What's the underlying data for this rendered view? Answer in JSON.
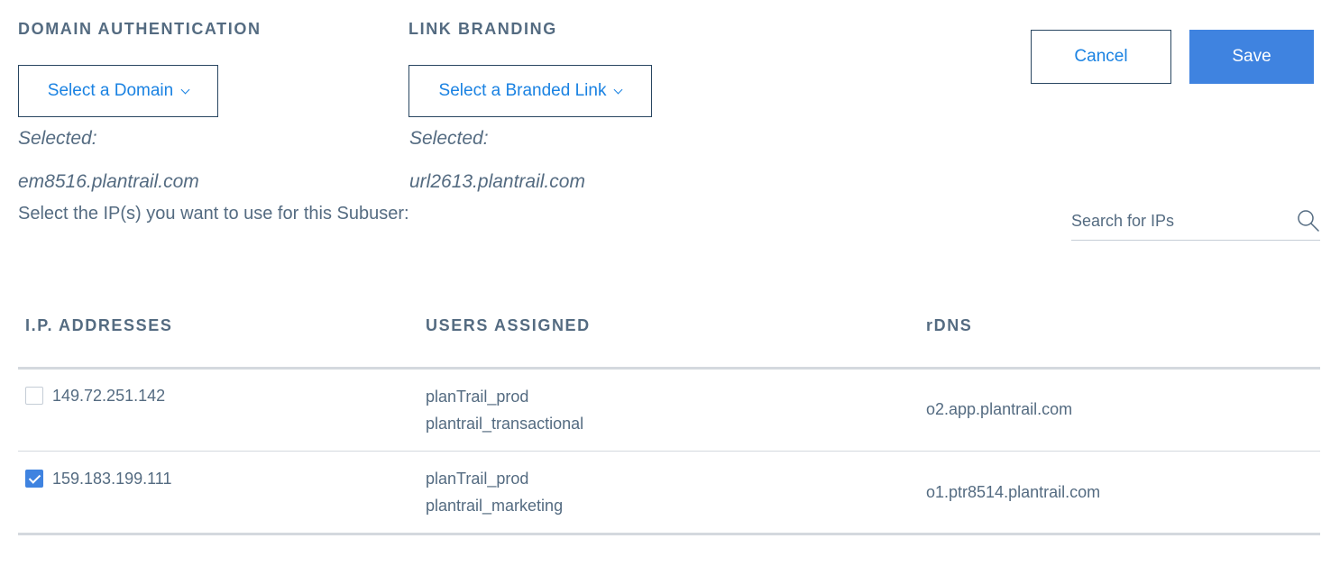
{
  "domain_auth": {
    "label": "DOMAIN AUTHENTICATION",
    "dropdown_label": "Select a Domain",
    "selected_label": "Selected:",
    "selected_value": "em8516.plantrail.com"
  },
  "link_branding": {
    "label": "LINK BRANDING",
    "dropdown_label": "Select a Branded Link",
    "selected_label": "Selected:",
    "selected_value": "url2613.plantrail.com"
  },
  "actions": {
    "cancel_label": "Cancel",
    "save_label": "Save"
  },
  "ip_prompt": "Select the IP(s) you want to use for this Subuser:",
  "search": {
    "placeholder": "Search for IPs",
    "value": ""
  },
  "table": {
    "headers": [
      "I.P. ADDRESSES",
      "USERS ASSIGNED",
      "rDNS"
    ],
    "rows": [
      {
        "checked": false,
        "ip": "149.72.251.142",
        "users": [
          "planTrail_prod",
          "plantrail_transactional"
        ],
        "rdns": "o2.app.plantrail.com"
      },
      {
        "checked": true,
        "ip": "159.183.199.111",
        "users": [
          "planTrail_prod",
          "plantrail_marketing"
        ],
        "rdns": "o1.ptr8514.plantrail.com"
      }
    ]
  },
  "colors": {
    "accent": "#1a82e2",
    "primary_button": "#3f83e0",
    "text": "#546b81",
    "border": "#294661"
  },
  "icons": {
    "search": "search-icon",
    "dropdown": "chevron-down-icon",
    "checkbox_checked": "check-icon"
  }
}
